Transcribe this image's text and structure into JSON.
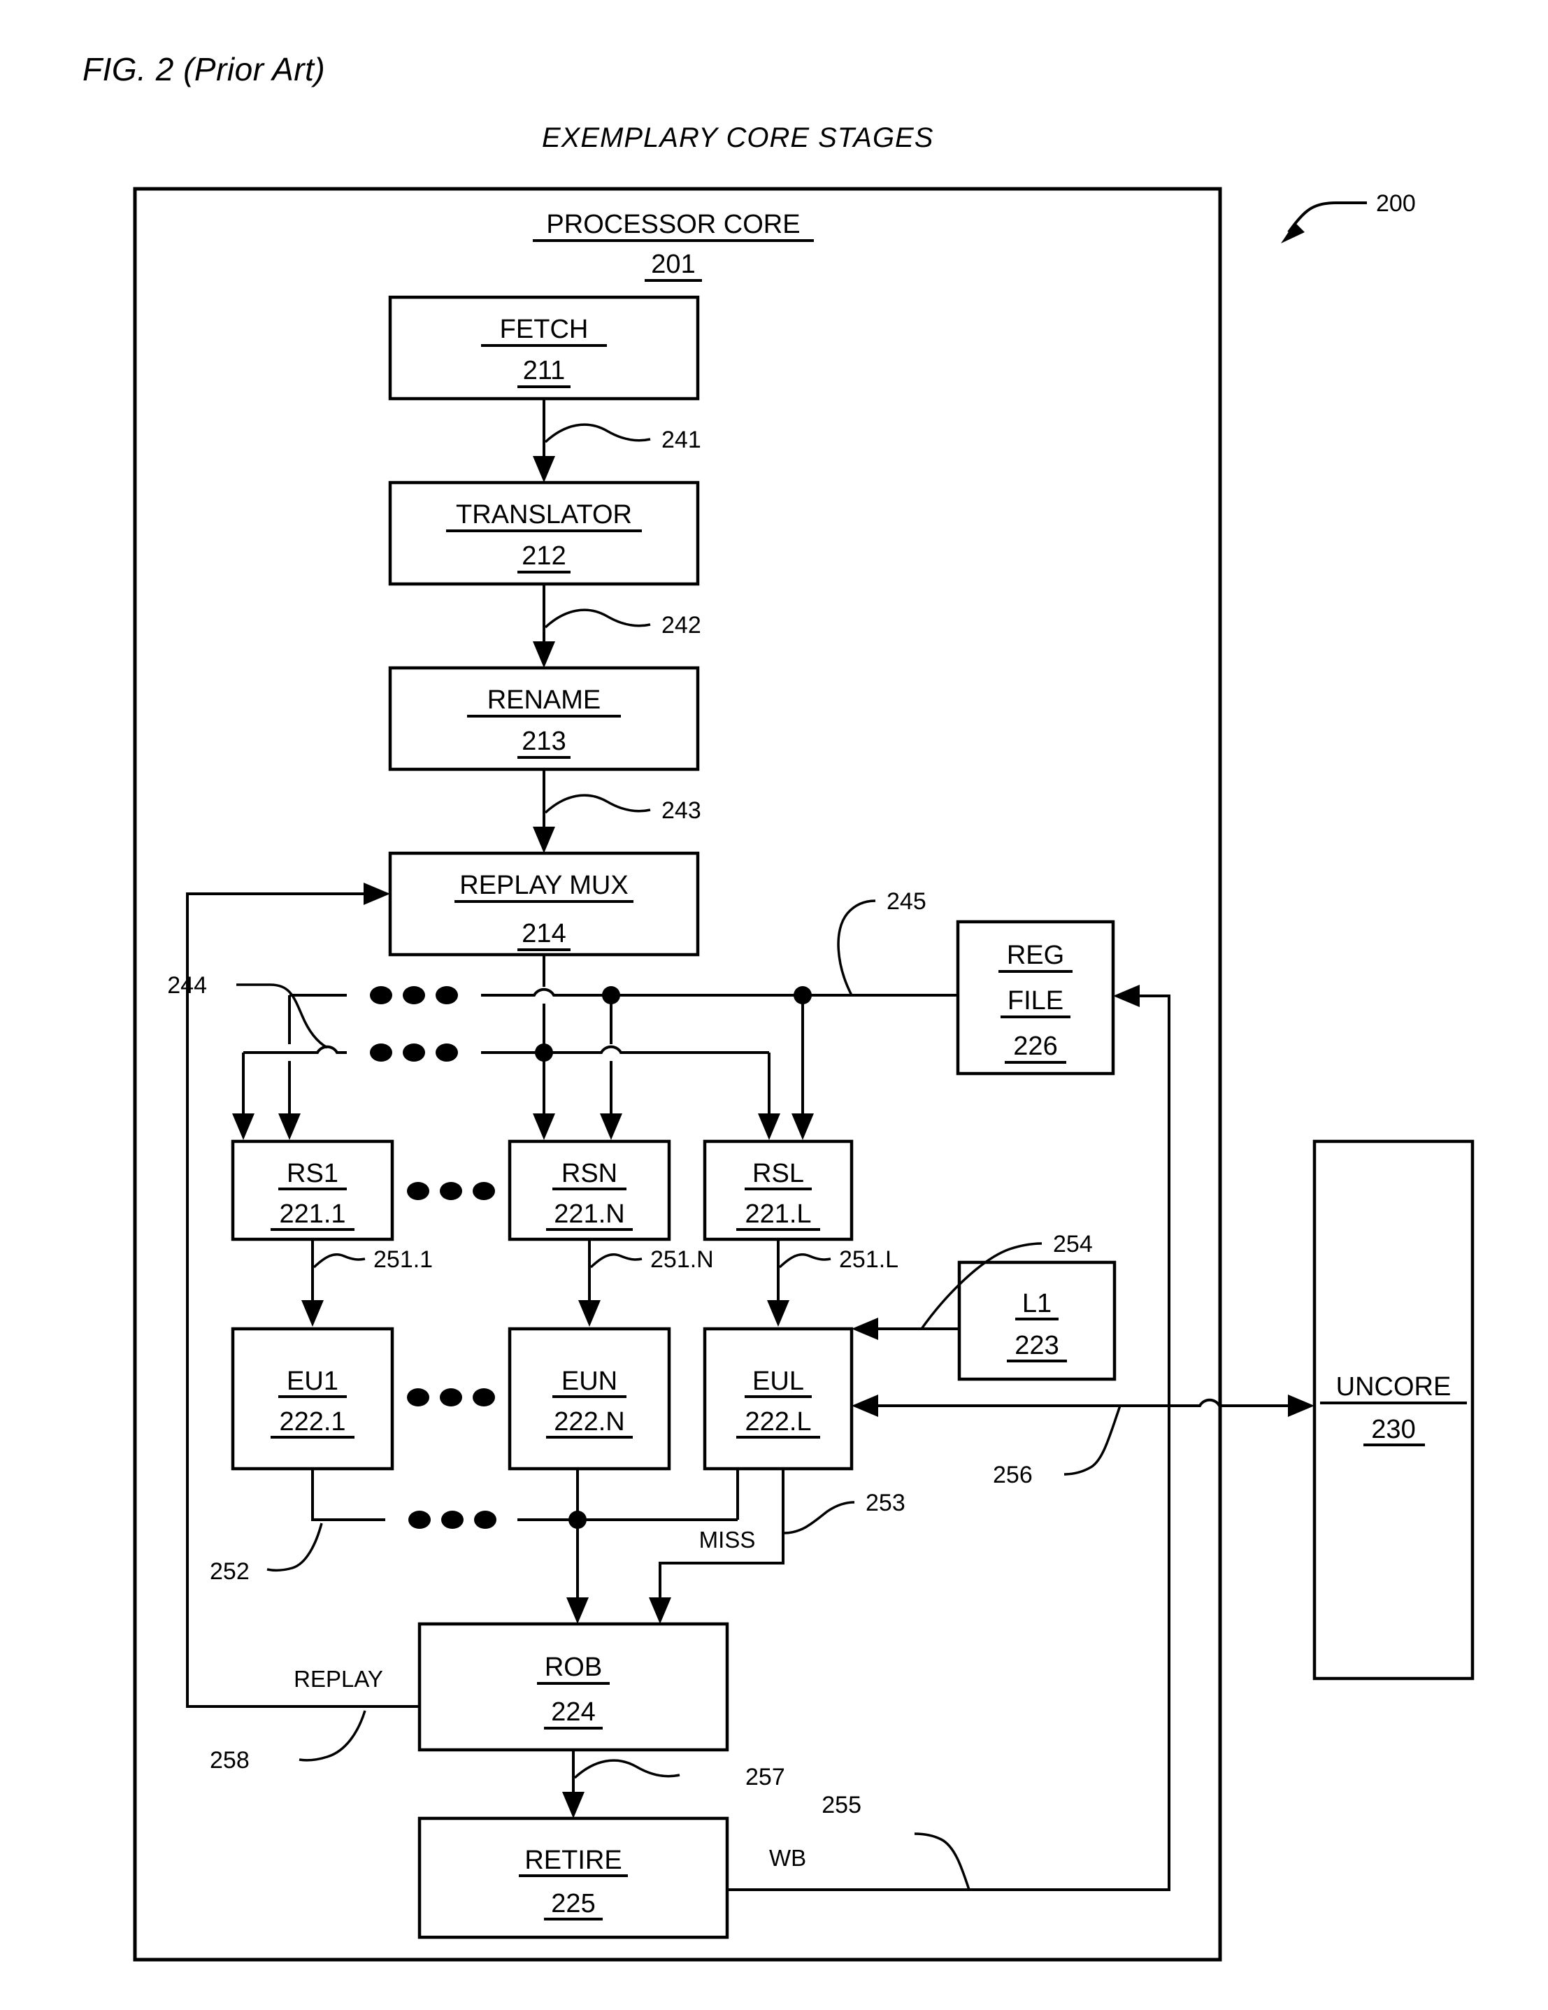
{
  "figure": {
    "label": "FIG. 2 (Prior Art)",
    "title": "EXEMPLARY CORE STAGES",
    "system_ref": "200"
  },
  "container": {
    "header": "PROCESSOR CORE",
    "header_ref": "201"
  },
  "blocks": {
    "fetch": {
      "label": "FETCH",
      "ref": "211"
    },
    "translator": {
      "label": "TRANSLATOR",
      "ref": "212"
    },
    "rename": {
      "label": "RENAME",
      "ref": "213"
    },
    "replay_mux": {
      "label": "REPLAY MUX",
      "ref": "214"
    },
    "reg_file": {
      "label_line1": "REG",
      "label_line2": "FILE",
      "ref": "226"
    },
    "rs1": {
      "label": "RS1",
      "ref": "221.1"
    },
    "rsn": {
      "label": "RSN",
      "ref": "221.N"
    },
    "rsl": {
      "label": "RSL",
      "ref": "221.L"
    },
    "eu1": {
      "label": "EU1",
      "ref": "222.1"
    },
    "eun": {
      "label": "EUN",
      "ref": "222.N"
    },
    "eul": {
      "label": "EUL",
      "ref": "222.L"
    },
    "l1": {
      "label": "L1",
      "ref": "223"
    },
    "rob": {
      "label": "ROB",
      "ref": "224"
    },
    "retire": {
      "label": "RETIRE",
      "ref": "225"
    },
    "uncore": {
      "label": "UNCORE",
      "ref": "230"
    }
  },
  "connectors": {
    "fetch_to_translator": "241",
    "translator_to_rename": "242",
    "rename_to_replaymux": "243",
    "operand_bus_left": "244",
    "operand_bus_right": "245",
    "rs1_to_eu1": "251.1",
    "rsn_to_eun": "251.N",
    "rsl_to_eul": "251.L",
    "eu_result_bus": "252",
    "miss_line": "253",
    "l1_to_eul": "254",
    "writeback_line": "255",
    "uncore_link": "256",
    "rob_to_retire": "257",
    "replay_line": "258"
  },
  "signals": {
    "miss": "MISS",
    "replay": "REPLAY",
    "writeback": "WB"
  },
  "colors": {
    "stroke": "#000000",
    "background": "#ffffff"
  }
}
